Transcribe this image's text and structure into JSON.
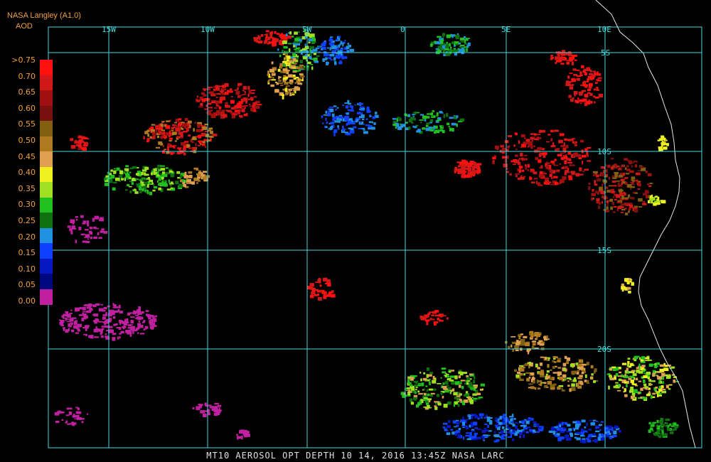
{
  "header": {
    "source": "NASA Langley (A1.0)",
    "product": "AOD"
  },
  "legend": {
    "labels": [
      ">0.75",
      "0.70",
      "0.65",
      "0.60",
      "0.55",
      "0.50",
      "0.45",
      "0.40",
      "0.35",
      "0.30",
      "0.25",
      "0.20",
      "0.15",
      "0.10",
      "0.05",
      "0.00"
    ],
    "colors": [
      "#ff1010",
      "#d01818",
      "#a01010",
      "#781010",
      "#806010",
      "#b07a20",
      "#e0a050",
      "#f0f020",
      "#a0e020",
      "#20c020",
      "#107010",
      "#2090e0",
      "#1040ff",
      "#0818c0",
      "#000880",
      "#c020a0"
    ]
  },
  "grid": {
    "lon_labels": [
      "15W",
      "10W",
      "5W",
      "0",
      "5E",
      "10E"
    ],
    "lat_labels": [
      "5S",
      "10S",
      "15S",
      "20S"
    ],
    "color": "#40d8e0"
  },
  "footer": {
    "text": "MT10  AEROSOL OPT DEPTH   10 14, 2016 13:45Z   NASA LARC"
  }
}
